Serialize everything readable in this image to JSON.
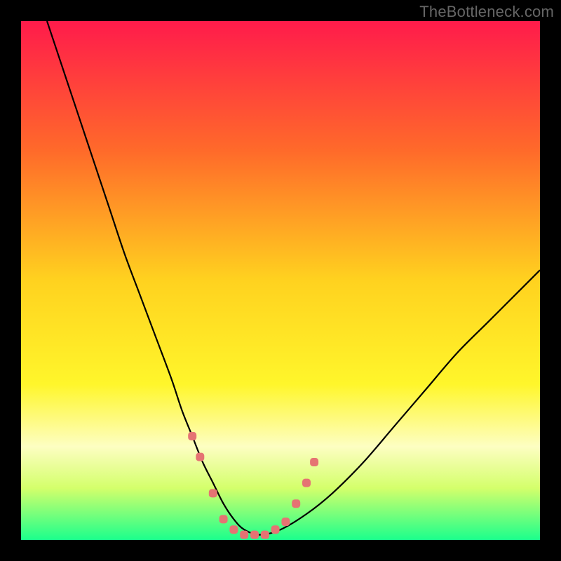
{
  "watermark": "TheBottleneck.com",
  "chart_data": {
    "type": "line",
    "title": "",
    "xlabel": "",
    "ylabel": "",
    "xlim": [
      0,
      100
    ],
    "ylim": [
      0,
      100
    ],
    "gradient_stops": [
      {
        "offset": 0.0,
        "color": "#ff1b4b"
      },
      {
        "offset": 0.25,
        "color": "#ff6a2a"
      },
      {
        "offset": 0.5,
        "color": "#ffd21f"
      },
      {
        "offset": 0.7,
        "color": "#fff62b"
      },
      {
        "offset": 0.82,
        "color": "#fdfec2"
      },
      {
        "offset": 0.9,
        "color": "#d4ff6b"
      },
      {
        "offset": 1.0,
        "color": "#1bff8c"
      }
    ],
    "series": [
      {
        "name": "bottleneck-curve",
        "color": "#000000",
        "x": [
          5,
          8,
          11,
          14,
          17,
          20,
          23,
          26,
          29,
          31,
          33,
          35,
          37,
          39,
          41,
          43,
          46,
          50,
          55,
          60,
          66,
          72,
          78,
          84,
          90,
          96,
          100
        ],
        "y": [
          100,
          91,
          82,
          73,
          64,
          55,
          47,
          39,
          31,
          25,
          20,
          15,
          11,
          7,
          4,
          2,
          1,
          2,
          5,
          9,
          15,
          22,
          29,
          36,
          42,
          48,
          52
        ]
      }
    ],
    "markers": {
      "name": "trough-markers",
      "color": "#e57373",
      "size": 12,
      "points": [
        {
          "x": 33,
          "y": 20
        },
        {
          "x": 34.5,
          "y": 16
        },
        {
          "x": 37,
          "y": 9
        },
        {
          "x": 39,
          "y": 4
        },
        {
          "x": 41,
          "y": 2
        },
        {
          "x": 43,
          "y": 1
        },
        {
          "x": 45,
          "y": 1
        },
        {
          "x": 47,
          "y": 1
        },
        {
          "x": 49,
          "y": 2
        },
        {
          "x": 51,
          "y": 3.5
        },
        {
          "x": 53,
          "y": 7
        },
        {
          "x": 55,
          "y": 11
        },
        {
          "x": 56.5,
          "y": 15
        }
      ]
    }
  }
}
